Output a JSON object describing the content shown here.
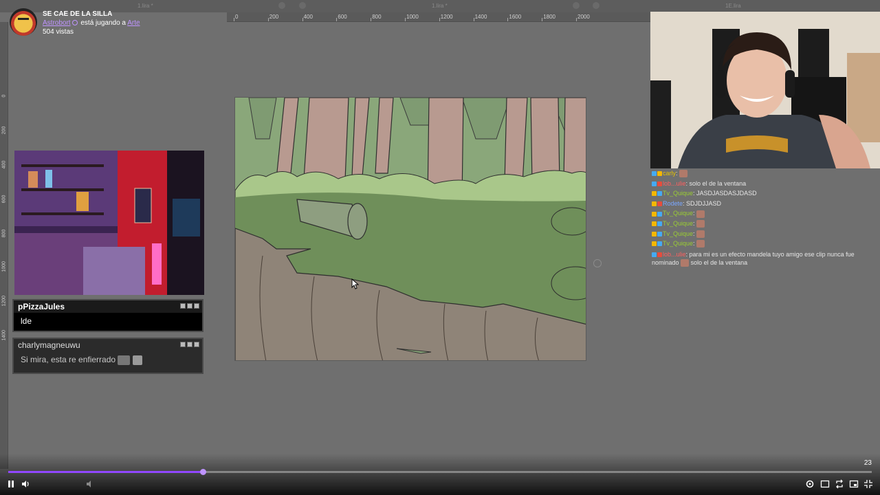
{
  "app": {
    "tabs": [
      "1.lira *",
      "1.lira *",
      "1E.lira"
    ],
    "ruler_top": [
      "0",
      "200",
      "400",
      "600",
      "800",
      "1000",
      "1200",
      "1400",
      "1600",
      "1800",
      "2000"
    ],
    "ruler_left": [
      "0",
      "200",
      "400",
      "600",
      "800",
      "1000",
      "1200",
      "1400"
    ]
  },
  "stream": {
    "title": "SE CAE DE LA SILLA",
    "streamer": "Astrobort",
    "playing_text": "está jugando a",
    "category": "Arte",
    "views": "504 vistas"
  },
  "popups": [
    {
      "name": "pPizzaJules",
      "message": "lde"
    },
    {
      "name": "charlymagneuwu",
      "message": "Si mira, esta re enfierrado"
    }
  ],
  "chat": [
    {
      "badges": [
        "blue",
        "gold"
      ],
      "user": "carly",
      "user_color": "gold",
      "text": "",
      "emote": true
    },
    {
      "badges": [
        "blue",
        "red"
      ],
      "user": "lob...ulie",
      "user_color": "red",
      "text": "solo el de la ventana",
      "emote": false
    },
    {
      "badges": [
        "gold",
        "blue"
      ],
      "user": "Tv_Quique",
      "user_color": "green",
      "text": "JASDJASDASJDASD",
      "emote": false
    },
    {
      "badges": [
        "gold",
        "red"
      ],
      "user": "Rodete",
      "user_color": "blue",
      "text": "SDJDJJASD",
      "emote": false
    },
    {
      "badges": [
        "gold",
        "blue"
      ],
      "user": "Tv_Quique",
      "user_color": "green",
      "text": "",
      "emote": true
    },
    {
      "badges": [
        "gold",
        "blue"
      ],
      "user": "Tv_Quique",
      "user_color": "green",
      "text": "",
      "emote": true
    },
    {
      "badges": [
        "gold",
        "blue"
      ],
      "user": "Tv_Quique",
      "user_color": "green",
      "text": "",
      "emote": true
    },
    {
      "badges": [
        "gold",
        "blue"
      ],
      "user": "Tv_Quique",
      "user_color": "green",
      "text": "",
      "emote": true
    }
  ],
  "chat_long": {
    "user": "lob...ulie",
    "text_a": "para mi es un efecto mandela tuyo amigo ese clip nunca fue nominado",
    "text_b": "solo el de la ventana"
  },
  "player": {
    "progress": 0.225,
    "count": "23",
    "icons": [
      "pause-icon",
      "volume-icon",
      "clip-icon",
      "settings-icon",
      "theater-icon",
      "popout-icon",
      "pip-icon",
      "fullscreen-icon"
    ]
  },
  "colors": {
    "accent": "#9147ff",
    "canvas_green": "#6f8f5a",
    "trunk": "#b89a90"
  }
}
